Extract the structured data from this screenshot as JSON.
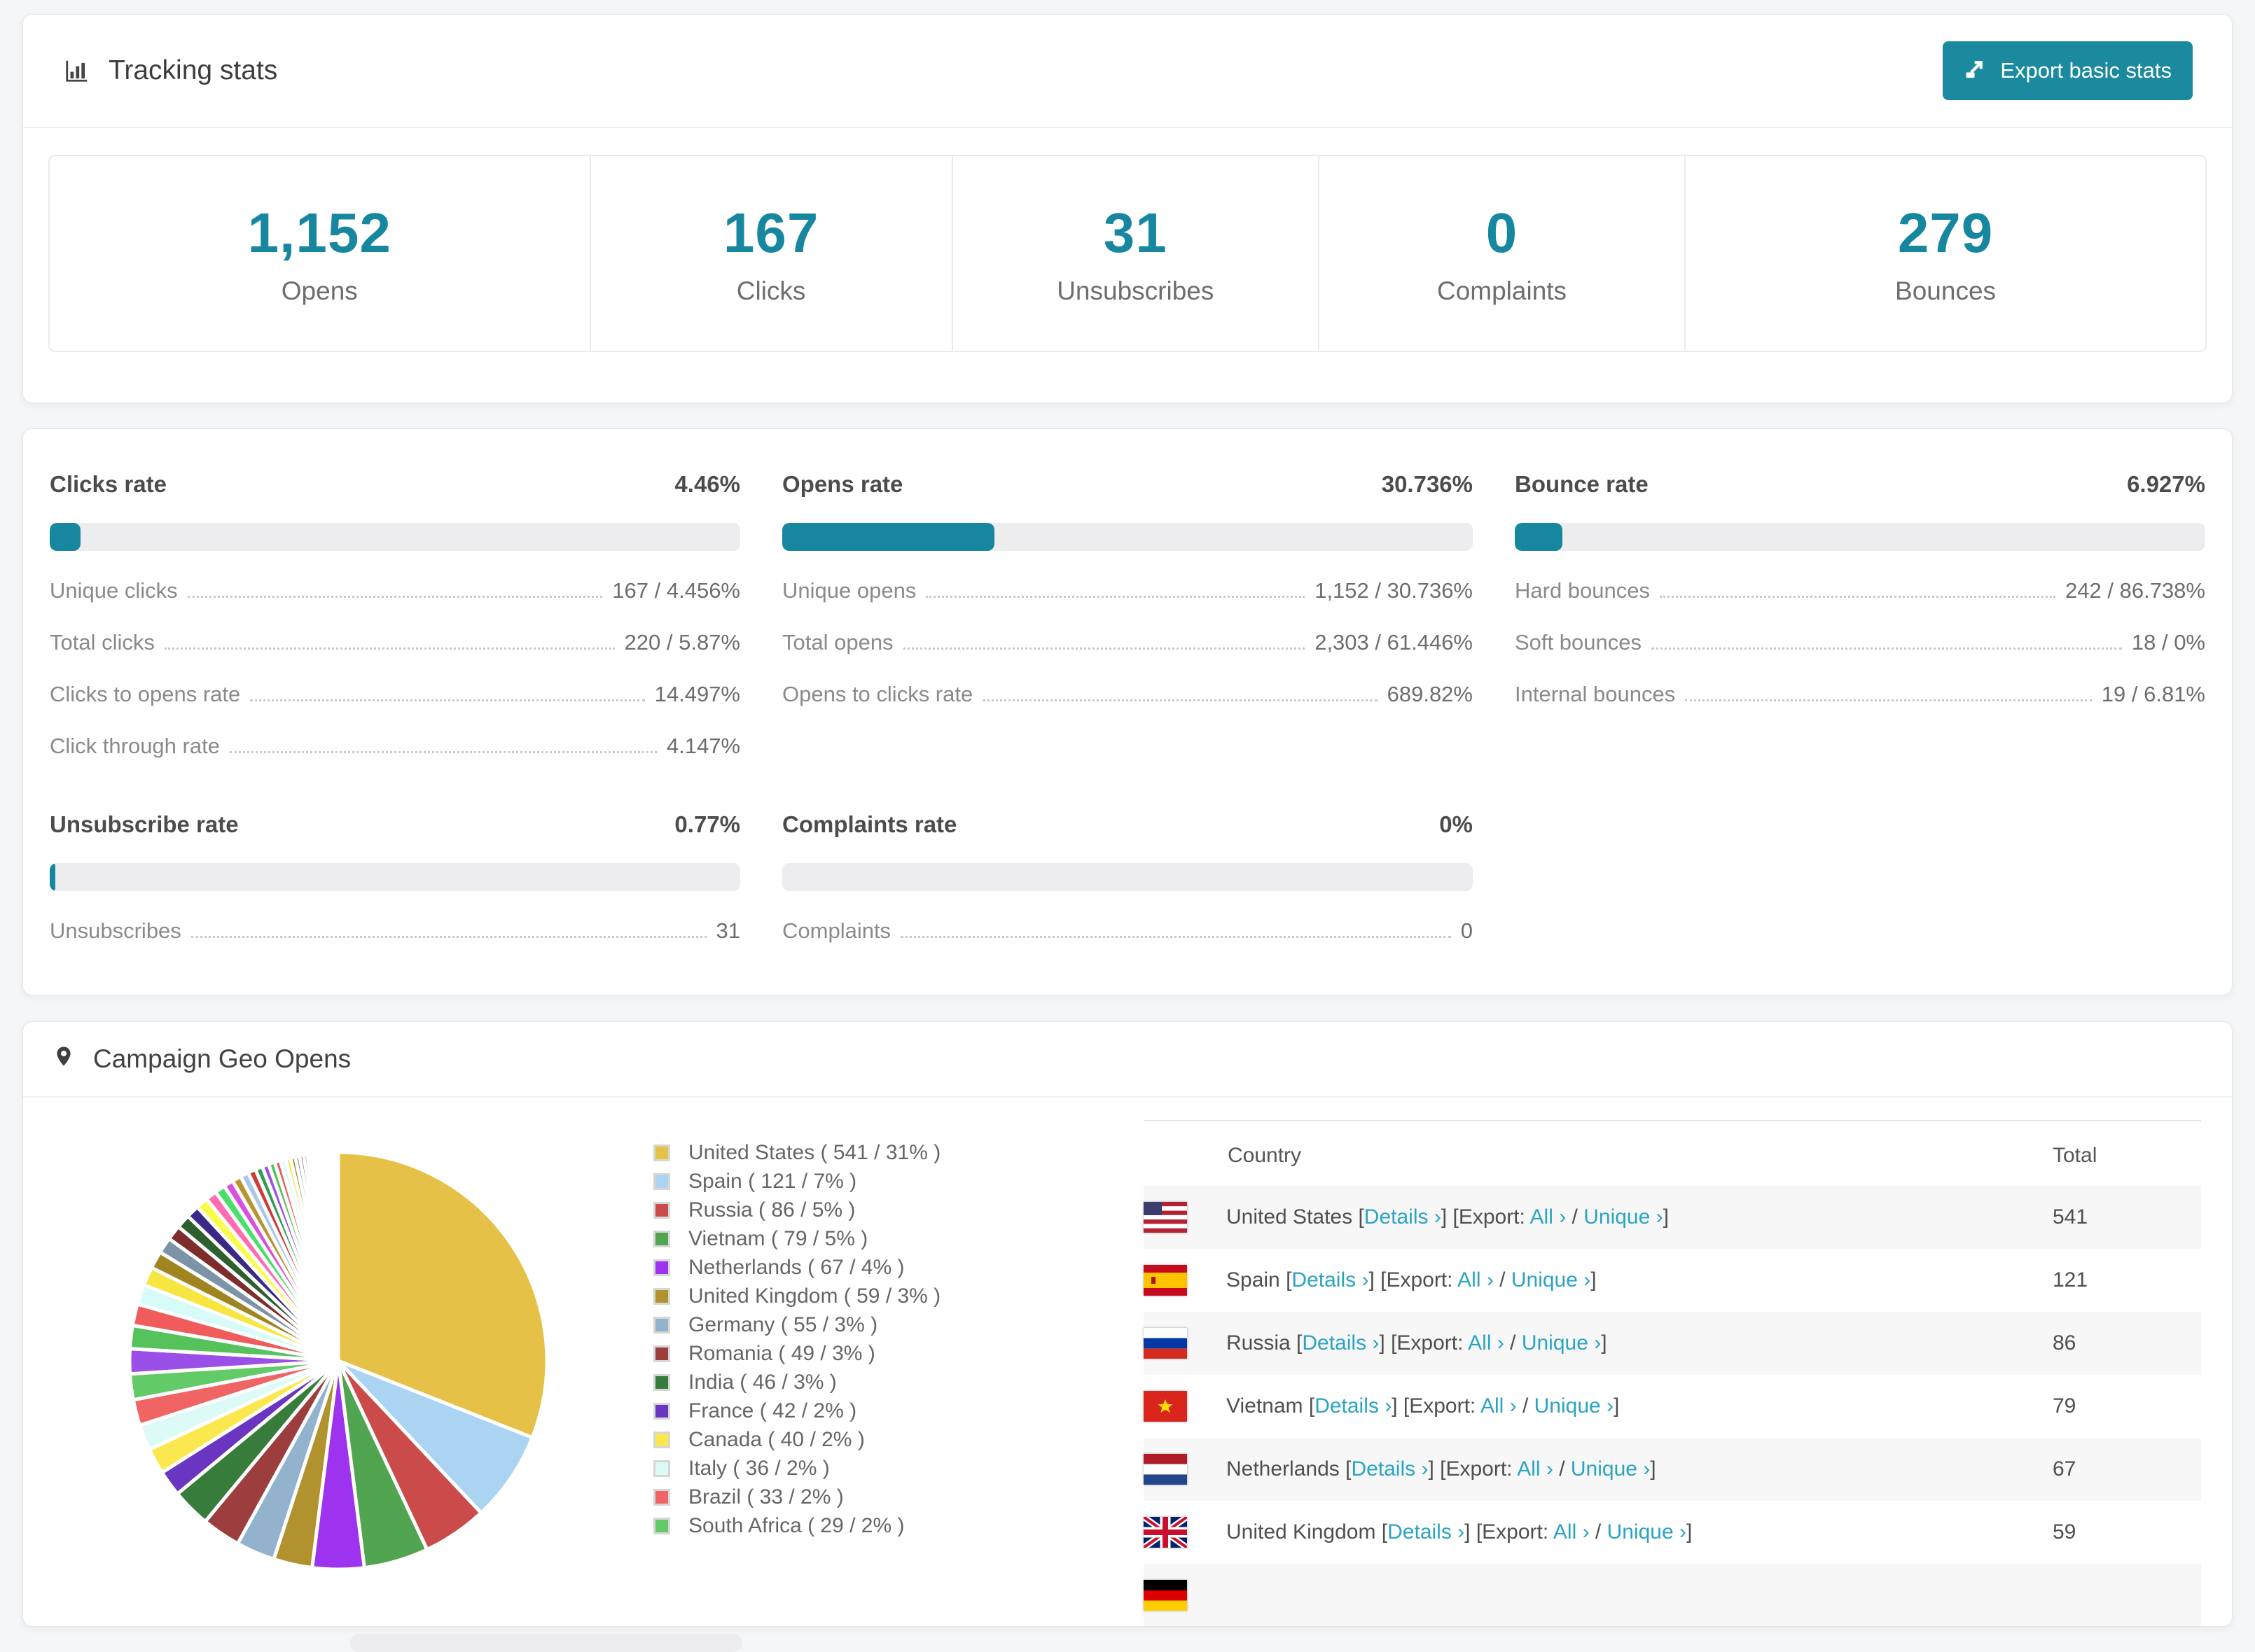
{
  "accents": {
    "teal": "#1787a0",
    "button_bg": "#1b8a9e",
    "link": "#2aa4c2"
  },
  "tracking_stats": {
    "title": "Tracking stats",
    "export_button_label": "Export basic stats",
    "summary": [
      {
        "value": "1,152",
        "label": "Opens"
      },
      {
        "value": "167",
        "label": "Clicks"
      },
      {
        "value": "31",
        "label": "Unsubscribes"
      },
      {
        "value": "0",
        "label": "Complaints"
      },
      {
        "value": "279",
        "label": "Bounces"
      }
    ]
  },
  "rates": {
    "blocks": [
      {
        "title": "Clicks rate",
        "value_label": "4.46%",
        "percent": 4.46,
        "rows": [
          {
            "label": "Unique clicks",
            "value": "167 / 4.456%"
          },
          {
            "label": "Total clicks",
            "value": "220 / 5.87%"
          },
          {
            "label": "Clicks to opens rate",
            "value": "14.497%"
          },
          {
            "label": "Click through rate",
            "value": "4.147%"
          }
        ]
      },
      {
        "title": "Opens rate",
        "value_label": "30.736%",
        "percent": 30.736,
        "rows": [
          {
            "label": "Unique opens",
            "value": "1,152 / 30.736%"
          },
          {
            "label": "Total opens",
            "value": "2,303 / 61.446%"
          },
          {
            "label": "Opens to clicks rate",
            "value": "689.82%"
          }
        ]
      },
      {
        "title": "Bounce rate",
        "value_label": "6.927%",
        "percent": 6.927,
        "rows": [
          {
            "label": "Hard bounces",
            "value": "242 / 86.738%"
          },
          {
            "label": "Soft bounces",
            "value": "18 / 0%"
          },
          {
            "label": "Internal bounces",
            "value": "19 / 6.81%"
          }
        ]
      },
      {
        "title": "Unsubscribe rate",
        "value_label": "0.77%",
        "percent": 0.77,
        "rows": [
          {
            "label": "Unsubscribes",
            "value": "31"
          }
        ]
      },
      {
        "title": "Complaints rate",
        "value_label": "0%",
        "percent": 0,
        "rows": [
          {
            "label": "Complaints",
            "value": "0"
          }
        ]
      }
    ]
  },
  "geo": {
    "title": "Campaign Geo Opens",
    "table": {
      "headers": [
        "Country",
        "Total"
      ],
      "link_labels": {
        "details": "Details ›",
        "export": "Export:",
        "all": "All ›",
        "unique": "Unique ›",
        "bracket_open": "[",
        "bracket_close": "]",
        "slash": "/"
      },
      "rows": [
        {
          "country": "United States",
          "flag": "us",
          "total": "541"
        },
        {
          "country": "Spain",
          "flag": "es",
          "total": "121"
        },
        {
          "country": "Russia",
          "flag": "ru",
          "total": "86"
        },
        {
          "country": "Vietnam",
          "flag": "vn",
          "total": "79"
        },
        {
          "country": "Netherlands",
          "flag": "nl",
          "total": "67"
        },
        {
          "country": "United Kingdom",
          "flag": "gb",
          "total": "59"
        }
      ],
      "partial_row": {
        "flag": "de"
      }
    }
  },
  "chart_data": {
    "type": "pie",
    "title": "Campaign Geo Opens",
    "legend_position": "right",
    "series": [
      {
        "name": "United States",
        "value": 541,
        "percent": 31,
        "color": "#e5c148"
      },
      {
        "name": "Spain",
        "value": 121,
        "percent": 7,
        "color": "#abd3f2"
      },
      {
        "name": "Russia",
        "value": 86,
        "percent": 5,
        "color": "#cb4b4b"
      },
      {
        "name": "Vietnam",
        "value": 79,
        "percent": 5,
        "color": "#51a551"
      },
      {
        "name": "Netherlands",
        "value": 67,
        "percent": 4,
        "color": "#9d33ee"
      },
      {
        "name": "United Kingdom",
        "value": 59,
        "percent": 3,
        "color": "#b2922f"
      },
      {
        "name": "Germany",
        "value": 55,
        "percent": 3,
        "color": "#92b2cd"
      },
      {
        "name": "Romania",
        "value": 49,
        "percent": 3,
        "color": "#9c3e3e"
      },
      {
        "name": "India",
        "value": 46,
        "percent": 3,
        "color": "#377c3b"
      },
      {
        "name": "France",
        "value": 42,
        "percent": 2,
        "color": "#6a35c0"
      },
      {
        "name": "Canada",
        "value": 40,
        "percent": 2,
        "color": "#fbe84e"
      },
      {
        "name": "Italy",
        "value": 36,
        "percent": 2,
        "color": "#dcfbf6"
      },
      {
        "name": "Brazil",
        "value": 33,
        "percent": 2,
        "color": "#f16464"
      },
      {
        "name": "South Africa",
        "value": 29,
        "percent": 2,
        "color": "#62ca67"
      }
    ],
    "unlabeled_tail": {
      "total_percent": 26,
      "slice_count": 40,
      "colors": [
        "#9a50e8",
        "#55c25c",
        "#f05c5c",
        "#d6fbf9",
        "#f7e642",
        "#a08420",
        "#7d94a6",
        "#7e2d2d",
        "#2d5f2f",
        "#3a2a85",
        "#f8fd4c",
        "#ff6db0",
        "#4adf6a",
        "#d94fe0",
        "#b89530",
        "#a8c8ea",
        "#cc3a3a",
        "#2f9e4f"
      ]
    }
  }
}
